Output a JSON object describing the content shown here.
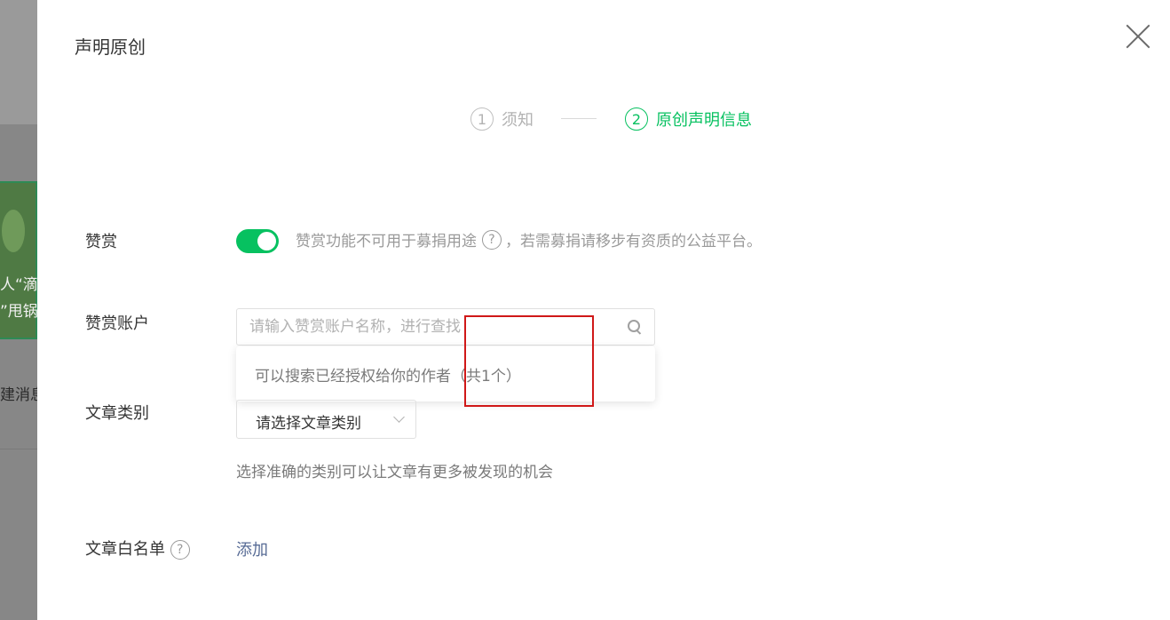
{
  "background": {
    "card_text_1": "人“滴",
    "card_text_2": "”甩锅",
    "message_text": "建消息"
  },
  "modal": {
    "title": "声明原创",
    "close_icon": "close-icon"
  },
  "steps": [
    {
      "number": "1",
      "label": "须知",
      "state": "inactive"
    },
    {
      "number": "2",
      "label": "原创声明信息",
      "state": "active"
    }
  ],
  "reward": {
    "label": "赞赏",
    "enabled": true,
    "tip_before": "赞赏功能不可用于募捐用途",
    "tip_help": "?",
    "tip_after": "，若需募捐请移步有资质的公益平台。"
  },
  "reward_account": {
    "label": "赞赏账户",
    "placeholder": "请输入赞赏账户名称，进行查找",
    "dropdown_hint": "可以搜索已经授权给你的作者（共1个）"
  },
  "category": {
    "label": "文章类别",
    "selected": "请选择文章类别",
    "tip": "选择准确的类别可以让文章有更多被发现的机会"
  },
  "whitelist": {
    "label": "文章白名单",
    "help": "?",
    "add_label": "添加"
  },
  "colors": {
    "accent": "#07c160",
    "link": "#576b95",
    "highlight_box": "#d01818"
  }
}
